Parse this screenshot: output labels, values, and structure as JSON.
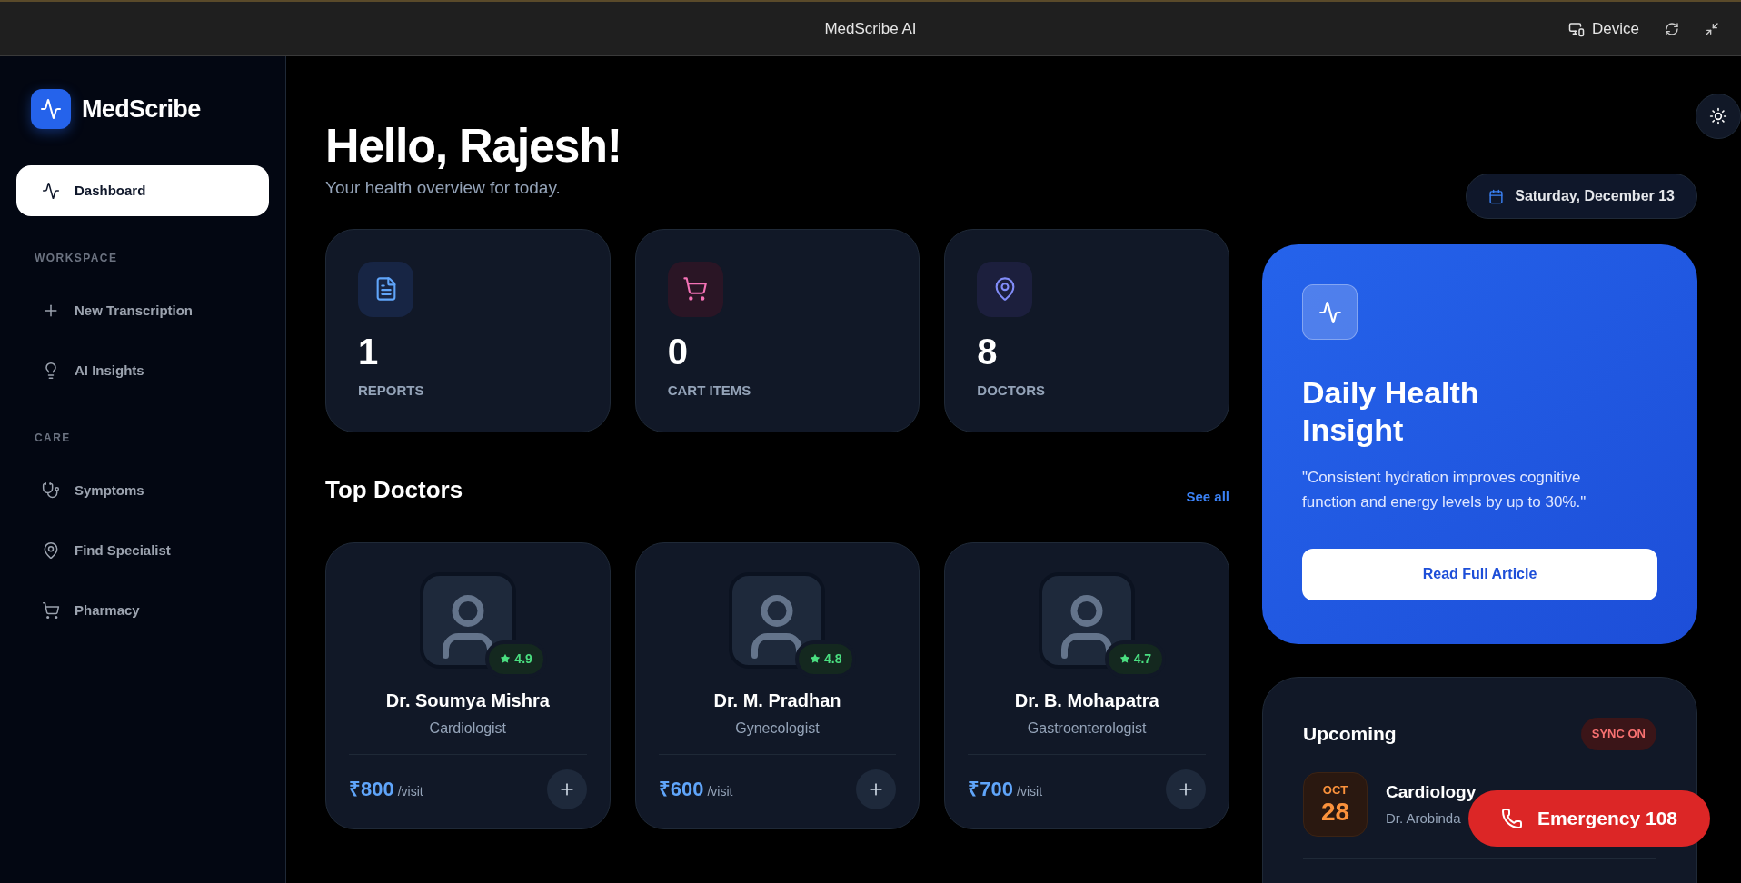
{
  "window": {
    "title": "MedScribe AI",
    "device_label": "Device"
  },
  "sidebar": {
    "brand": "MedScribe",
    "top_item": {
      "label": "Dashboard",
      "selected": true
    },
    "sections": [
      {
        "title": "WORKSPACE",
        "items": [
          {
            "label": "New Transcription",
            "selected": false
          },
          {
            "label": "AI Insights",
            "selected": false
          }
        ]
      },
      {
        "title": "CARE",
        "items": [
          {
            "label": "Symptoms",
            "selected": false
          },
          {
            "label": "Find Specialist",
            "selected": false
          },
          {
            "label": "Pharmacy",
            "selected": false
          }
        ]
      }
    ]
  },
  "header": {
    "greeting": "Hello, Rajesh!",
    "subtitle": "Your health overview for today.",
    "date": "Saturday, December 13"
  },
  "stats": [
    {
      "value": "1",
      "label": "REPORTS"
    },
    {
      "value": "0",
      "label": "CART ITEMS"
    },
    {
      "value": "8",
      "label": "DOCTORS"
    }
  ],
  "top_doctors": {
    "title": "Top Doctors",
    "see_all": "See all",
    "doctors": [
      {
        "name": "Dr. Soumya Mishra",
        "specialty": "Cardiologist",
        "rating": "4.9",
        "price": "₹800",
        "unit": "/visit"
      },
      {
        "name": "Dr. M. Pradhan",
        "specialty": "Gynecologist",
        "rating": "4.8",
        "price": "₹600",
        "unit": "/visit"
      },
      {
        "name": "Dr. B. Mohapatra",
        "specialty": "Gastroenterologist",
        "rating": "4.7",
        "price": "₹700",
        "unit": "/visit"
      }
    ]
  },
  "insight": {
    "title": "Daily Health Insight",
    "quote": "\"Consistent hydration improves cognitive function and energy levels by up to 30%.\"",
    "button": "Read Full Article"
  },
  "upcoming": {
    "title": "Upcoming",
    "badge": "SYNC ON",
    "appointments": [
      {
        "month": "OCT",
        "day": "28",
        "title": "Cardiology",
        "doctor": "Dr. Arobinda"
      }
    ]
  },
  "emergency": {
    "label": "Emergency 108"
  }
}
